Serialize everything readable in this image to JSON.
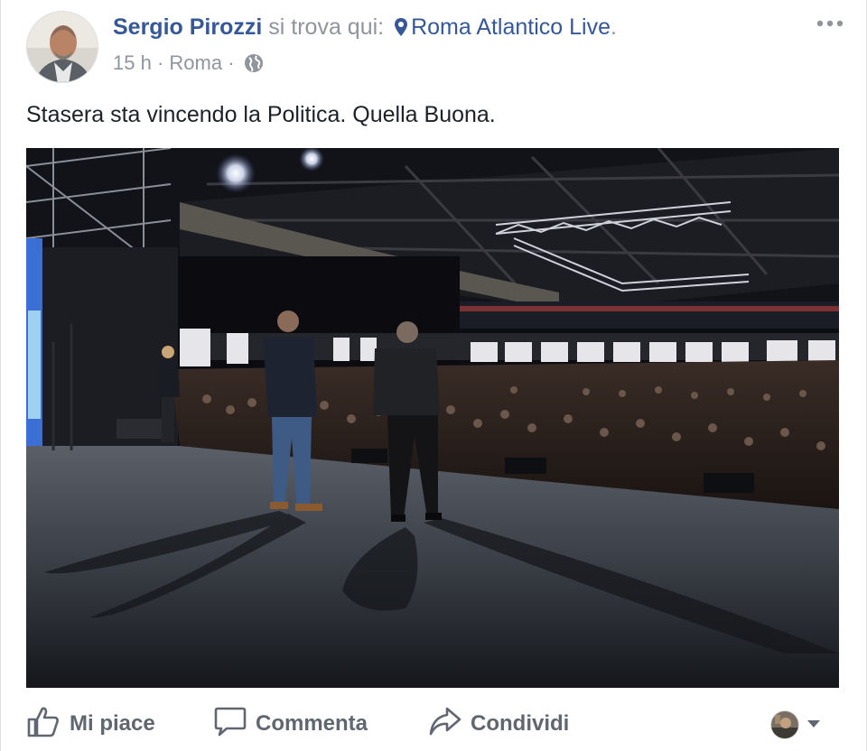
{
  "post": {
    "author": "Sergio Pirozzi",
    "checkin_text": "si trova qui:",
    "location": "Roma Atlantico Live",
    "location_period": ".",
    "time": "15 h",
    "separator": "·",
    "city": "Roma",
    "text": "Stasera sta vincendo la Politica. Quella Buona.",
    "icons": {
      "more": "more-options-icon",
      "pin": "location-pin-icon",
      "privacy": "globe-icon",
      "like": "thumbs-up-icon",
      "comment": "comment-bubble-icon",
      "share": "share-arrow-icon",
      "audience_caret": "caret-down-icon"
    }
  },
  "actions": {
    "like": "Mi piace",
    "comment": "Commenta",
    "share": "Condividi"
  },
  "colors": {
    "link": "#365899",
    "secondary": "#90949c",
    "text": "#1d2129",
    "action": "#606770"
  }
}
